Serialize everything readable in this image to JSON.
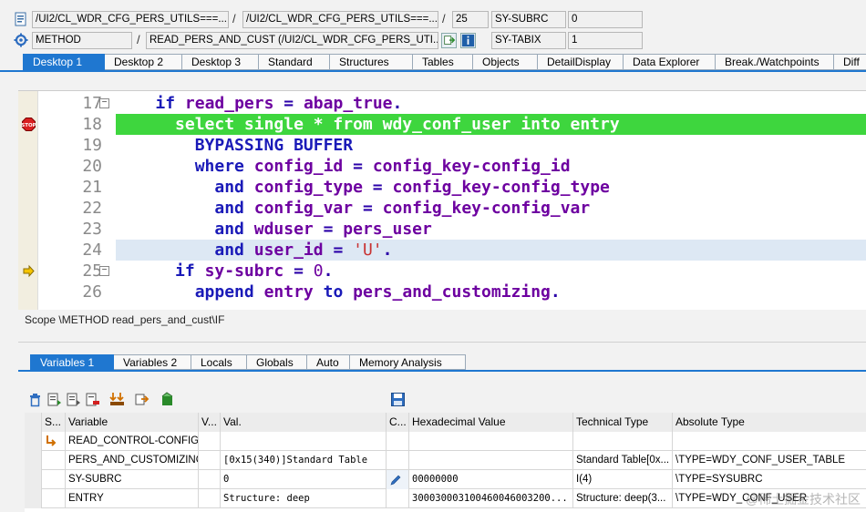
{
  "header": {
    "row1": {
      "program": "/UI2/CL_WDR_CFG_PERS_UTILS===...",
      "include": "/UI2/CL_WDR_CFG_PERS_UTILS===...",
      "line": "25",
      "var1_name": "SY-SUBRC",
      "var1_value": "0"
    },
    "row2": {
      "event_type": "METHOD",
      "event": "READ_PERS_AND_CUST (/UI2/CL_WDR_CFG_PERS_UTI...",
      "var2_name": "SY-TABIX",
      "var2_value": "1"
    }
  },
  "desktop_tabs": [
    "Desktop 1",
    "Desktop 2",
    "Desktop 3",
    "Standard",
    "Structures",
    "Tables",
    "Objects",
    "DetailDisplay",
    "Data Explorer",
    "Break./Watchpoints",
    "Diff"
  ],
  "code": {
    "line_numbers": [
      "17",
      "18",
      "19",
      "20",
      "21",
      "22",
      "23",
      "24",
      "25",
      "26"
    ],
    "l17": {
      "a": "if",
      "b": "read_pers",
      "c": "=",
      "d": "abap_true",
      "e": "."
    },
    "l18": "select single * from wdy_conf_user into entry",
    "l19": "BYPASSING BUFFER",
    "l20": {
      "a": "where",
      "b": "config_id",
      "c": "=",
      "d": "config_key-config_id"
    },
    "l21": {
      "a": "and",
      "b": "config_type",
      "c": "=",
      "d": "config_key-config_type"
    },
    "l22": {
      "a": "and",
      "b": "config_var",
      "c": "=",
      "d": "config_key-config_var"
    },
    "l23": {
      "a": "and",
      "b": "wduser",
      "c": "=",
      "d": "pers_user"
    },
    "l24": {
      "a": "and",
      "b": "user_id",
      "c": "=",
      "d": "'U'",
      "e": "."
    },
    "l25": {
      "a": "if",
      "b": "sy-subrc",
      "c": "=",
      "d": "0",
      "e": "."
    },
    "l26": {
      "a": "append",
      "b": "entry",
      "c": "to",
      "d": "pers_and_customizing",
      "e": "."
    }
  },
  "scope": "Scope \\METHOD read_pers_and_cust\\IF",
  "var_tabs": [
    "Variables 1",
    "Variables 2",
    "Locals",
    "Globals",
    "Auto",
    "Memory Analysis"
  ],
  "grid": {
    "headers": [
      "S...",
      "Variable",
      "V...",
      "Val.",
      "C...",
      "Hexadecimal Value",
      "Technical Type",
      "Absolute Type"
    ],
    "rows": [
      {
        "variable": "READ_CONTROL-CONFIG...",
        "value": "",
        "hex": "",
        "tech": "",
        "abs": ""
      },
      {
        "variable": "PERS_AND_CUSTOMIZING",
        "value": "[0x15(340)]Standard Table",
        "hex": "",
        "tech": "Standard Table[0x...",
        "abs": "\\TYPE=WDY_CONF_USER_TABLE"
      },
      {
        "variable": "SY-SUBRC",
        "value": "0",
        "hex": "00000000",
        "tech": "I(4)",
        "abs": "\\TYPE=SYSUBRC"
      },
      {
        "variable": "ENTRY",
        "value": "Structure: deep",
        "hex": "300030003100460046003200...",
        "tech": "Structure: deep(3...",
        "abs": "\\TYPE=WDY_CONF_USER"
      }
    ]
  },
  "watermark": "@稀土掘金技术社区"
}
